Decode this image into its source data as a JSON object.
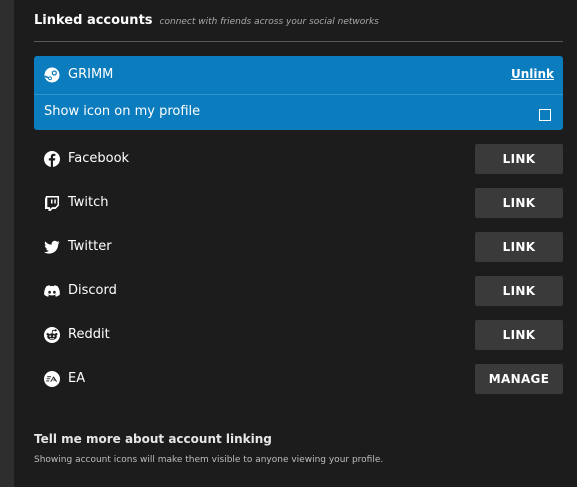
{
  "header": {
    "title": "Linked accounts",
    "subtitle": "connect with friends across your social networks"
  },
  "linked": {
    "name": "GRIMM",
    "icon": "steam-icon",
    "unlink_label": "Unlink",
    "show_icon_label": "Show icon on my profile",
    "show_icon_checked": false,
    "accent_color": "#0b7cbd"
  },
  "accounts": [
    {
      "name": "Facebook",
      "icon": "facebook-icon",
      "action": "LINK"
    },
    {
      "name": "Twitch",
      "icon": "twitch-icon",
      "action": "LINK"
    },
    {
      "name": "Twitter",
      "icon": "twitter-icon",
      "action": "LINK"
    },
    {
      "name": "Discord",
      "icon": "discord-icon",
      "action": "LINK"
    },
    {
      "name": "Reddit",
      "icon": "reddit-icon",
      "action": "LINK"
    },
    {
      "name": "EA",
      "icon": "ea-icon",
      "action": "MANAGE"
    }
  ],
  "footer": {
    "title": "Tell me more about account linking",
    "text": "Showing account icons will make them visible to anyone viewing your profile."
  }
}
